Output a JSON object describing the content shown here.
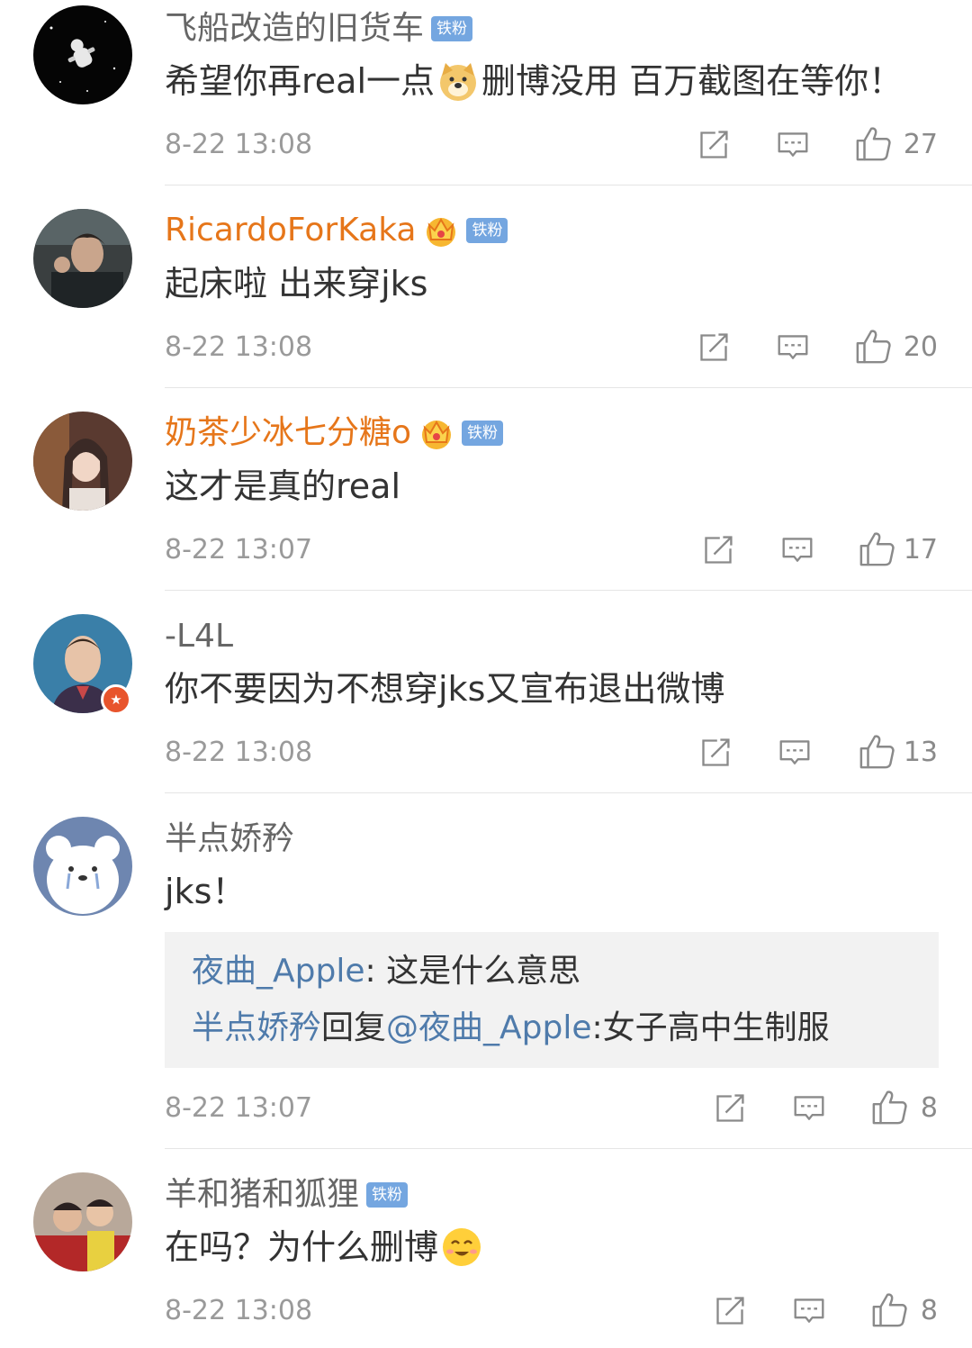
{
  "comments": [
    {
      "username": "飞船改造的旧货车",
      "fan_badge": "铁粉",
      "text_a": "希望你再real一点",
      "text_b": "删博没用 百万截图在等你！",
      "time": "8-22 13:08",
      "likes": "27"
    },
    {
      "username": "RicardoForKaka",
      "fan_badge": "铁粉",
      "text": "起床啦 出来穿jks",
      "time": "8-22 13:08",
      "likes": "20"
    },
    {
      "username": "奶茶少冰七分糖o",
      "fan_badge": "铁粉",
      "text": "这才是真的real",
      "time": "8-22 13:07",
      "likes": "17"
    },
    {
      "username": "-L4L",
      "text": "你不要因为不想穿jks又宣布退出微博",
      "time": "8-22 13:08",
      "likes": "13"
    },
    {
      "username": "半点娇矜",
      "text": "jks！",
      "replies": [
        {
          "author": "夜曲_Apple",
          "sep": ": ",
          "text": "这是什么意思"
        },
        {
          "author": "半点娇矜",
          "action": "回复",
          "mention": "@夜曲_Apple",
          "sep": ":",
          "text": "女子高中生制服"
        }
      ],
      "time": "8-22 13:07",
      "likes": "8"
    },
    {
      "username": "羊和猪和狐狸",
      "fan_badge": "铁粉",
      "text": "在吗？为什么删博",
      "time": "8-22 13:08",
      "likes": "8"
    }
  ],
  "colors": {
    "username_default": "#666666",
    "username_vip": "#e6761a",
    "link_blue": "#4f7bab",
    "fan_badge": "#74a6e0"
  },
  "icons": [
    "repost-icon",
    "comment-icon",
    "like-icon",
    "crown-icon",
    "doge-emoji",
    "smile-emoji",
    "verified-badge-icon"
  ]
}
